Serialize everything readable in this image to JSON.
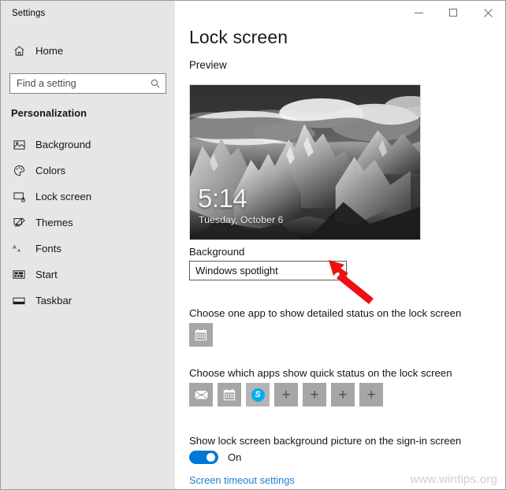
{
  "window": {
    "app_title": "Settings",
    "caption": {
      "minimize": "minimize-icon",
      "maximize": "maximize-icon",
      "close": "close-icon"
    }
  },
  "sidebar": {
    "home_label": "Home",
    "home_icon": "home-icon",
    "search": {
      "placeholder": "Find a setting",
      "value": "",
      "icon": "search-icon"
    },
    "section_header": "Personalization",
    "items": [
      {
        "label": "Background",
        "icon": "picture-icon"
      },
      {
        "label": "Colors",
        "icon": "palette-icon"
      },
      {
        "label": "Lock screen",
        "icon": "lock-screen-icon"
      },
      {
        "label": "Themes",
        "icon": "themes-icon"
      },
      {
        "label": "Fonts",
        "icon": "fonts-icon"
      },
      {
        "label": "Start",
        "icon": "start-icon"
      },
      {
        "label": "Taskbar",
        "icon": "taskbar-icon"
      }
    ]
  },
  "main": {
    "page_title": "Lock screen",
    "preview_label": "Preview",
    "preview": {
      "clock_time": "5:14",
      "clock_date": "Tuesday, October 6",
      "image_description": "grayscale mountain landscape with clouds"
    },
    "background": {
      "label": "Background",
      "selected": "Windows spotlight",
      "chevron_icon": "chevron-down-icon"
    },
    "detailed_status": {
      "text": "Choose one app to show detailed status on the lock screen",
      "tiles": [
        {
          "name": "calendar",
          "icon": "calendar-icon"
        }
      ]
    },
    "quick_status": {
      "text": "Choose which apps show quick status on the lock screen",
      "tiles": [
        {
          "name": "mail",
          "icon": "mail-icon",
          "type": "app"
        },
        {
          "name": "calendar",
          "icon": "calendar-icon",
          "type": "app"
        },
        {
          "name": "skype",
          "icon": "skype-icon",
          "type": "app",
          "glyph": "S"
        },
        {
          "name": "add-1",
          "icon": "plus-icon",
          "type": "add",
          "glyph": "+"
        },
        {
          "name": "add-2",
          "icon": "plus-icon",
          "type": "add",
          "glyph": "+"
        },
        {
          "name": "add-3",
          "icon": "plus-icon",
          "type": "add",
          "glyph": "+"
        },
        {
          "name": "add-4",
          "icon": "plus-icon",
          "type": "add",
          "glyph": "+"
        }
      ]
    },
    "signin_setting": {
      "text": "Show lock screen background picture on the sign-in screen",
      "toggle_state": "On"
    },
    "timeout_link": "Screen timeout settings"
  },
  "annotation": {
    "arrow_color": "#ee1111",
    "arrow_target": "background-dropdown-chevron"
  },
  "watermark": "www.wintips.org",
  "colors": {
    "sidebar_bg": "#e6e6e6",
    "accent": "#0078d7",
    "link": "#1f7fd4",
    "tile_bg": "#a6a6a6",
    "skype_blue": "#00aff0"
  }
}
